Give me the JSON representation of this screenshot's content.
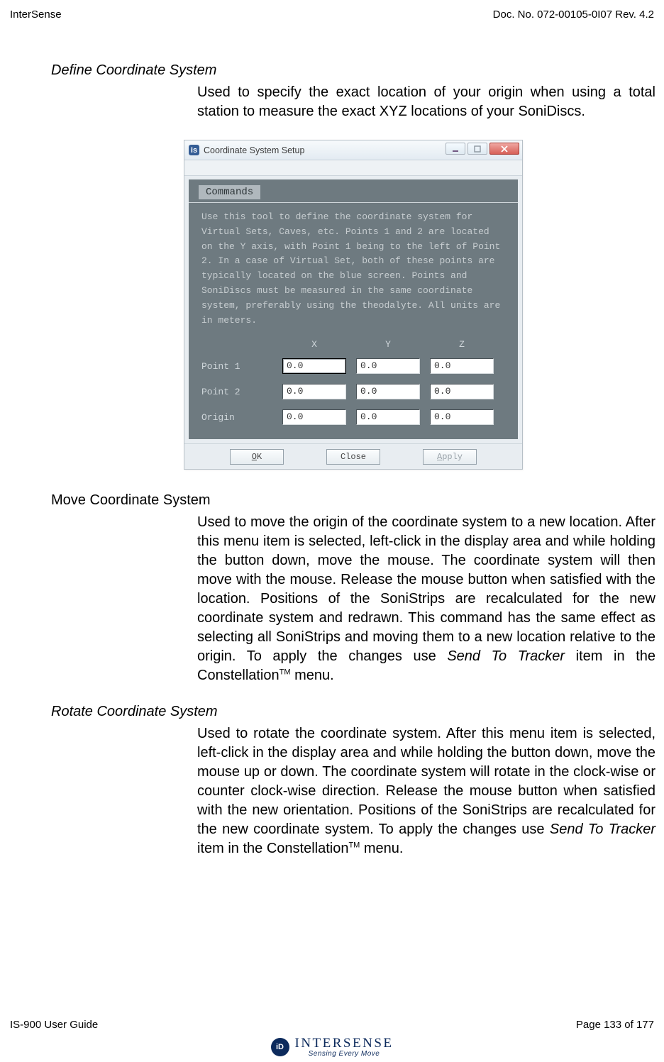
{
  "header": {
    "left": "InterSense",
    "right": "Doc. No. 072-00105-0I07 Rev. 4.2"
  },
  "sections": {
    "define": {
      "title": "Define Coordinate System",
      "body": "Used to specify the exact location of your origin when using a total station to measure the exact XYZ locations of your SoniDiscs."
    },
    "move": {
      "title": "Move Coordinate System",
      "body_a": "Used to move the origin of the coordinate system to a new location. After this menu item is selected, left-click in the display area and while holding the button down, move the mouse. The coordinate system will then move with the mouse. Release the mouse button when satisfied with the location. Positions of the SoniStrips are recalculated for the new coordinate system and redrawn. This command has the same effect as selecting all SoniStrips and moving them to a new location relative to the origin. To apply the changes use ",
      "body_item": "Send To Tracker",
      "body_b": " item in the Constellation",
      "body_c": " menu."
    },
    "rotate": {
      "title": "Rotate Coordinate System",
      "body_a": "Used to rotate the coordinate system. After this menu item is selected, left-click in the display area and while holding the button down, move the mouse up or down. The coordinate system will rotate in the clock-wise or counter clock-wise direction. Release the mouse button when satisfied with the new orientation. Positions of the SoniStrips are recalculated for the new coordinate system. To apply the changes use ",
      "body_item": "Send To Tracker",
      "body_b": " item in the Constellation",
      "body_c": " menu."
    }
  },
  "dialog": {
    "title": "Coordinate System Setup",
    "menu": "Commands",
    "desc": "Use this tool to define the coordinate system for Virtual Sets, Caves, etc. Points 1 and 2 are located on the Y axis, with Point 1 being to the left of Point 2. In a case of Virtual Set, both of these points are typically located on the blue screen. Points and SoniDiscs must be measured in the same coordinate system, preferably using the theodalyte. All units are in meters.",
    "cols": {
      "x": "X",
      "y": "Y",
      "z": "Z"
    },
    "rows": {
      "p1": {
        "label": "Point 1",
        "x": "0.0",
        "y": "0.0",
        "z": "0.0"
      },
      "p2": {
        "label": "Point 2",
        "x": "0.0",
        "y": "0.0",
        "z": "0.0"
      },
      "or": {
        "label": "Origin",
        "x": "0.0",
        "y": "0.0",
        "z": "0.0"
      }
    },
    "buttons": {
      "ok": "OK",
      "close": "Close",
      "apply": "Apply"
    }
  },
  "footer": {
    "left": "IS-900 User Guide",
    "right": "Page 133 of 177"
  },
  "logo": {
    "name": "INTERSENSE",
    "sub": "Sensing Every Move"
  },
  "tm": "TM"
}
